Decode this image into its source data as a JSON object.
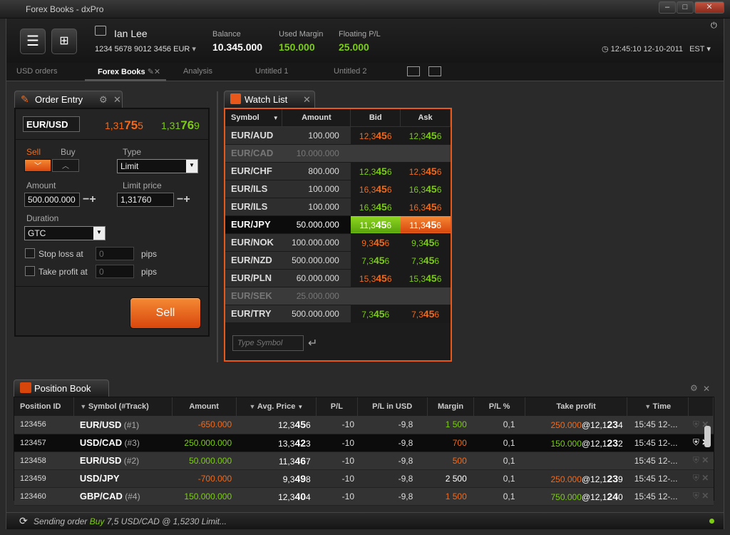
{
  "window": {
    "title": "Forex Books - dxPro"
  },
  "account": {
    "name": "Ian Lee",
    "number": "1234 5678 9012 3456",
    "currency": "EUR"
  },
  "balances": [
    {
      "label": "Balance",
      "value": "10.345.000",
      "color": "#ffffff"
    },
    {
      "label": "Used Margin",
      "value": "150.000",
      "color": "#7ccd13"
    },
    {
      "label": "Floating P/L",
      "value": "25.000",
      "color": "#7ccd13"
    }
  ],
  "clock": {
    "time": "12:45:10 12-10-2011",
    "tz": "EST"
  },
  "tabs": [
    "USD orders",
    "Forex Books",
    "Analysis",
    "Untitled 1",
    "Untitled 2"
  ],
  "active_tab": "Forex Books",
  "order_entry": {
    "title": "Order Entry",
    "symbol": "EUR/USD",
    "bid": {
      "pre": "1,31",
      "big": "75",
      "sup": "5"
    },
    "ask": {
      "pre": "1,31",
      "big": "76",
      "sup": "9"
    },
    "sell_label": "Sell",
    "buy_label": "Buy",
    "type_label": "Type",
    "type_value": "Limit",
    "amount_label": "Amount",
    "amount_value": "500.000.000",
    "limit_label": "Limit price",
    "limit_value": "1,31760",
    "duration_label": "Duration",
    "duration_value": "GTC",
    "stop_loss_label": "Stop loss at",
    "stop_loss_value": "0",
    "take_profit_label": "Take profit at",
    "take_profit_value": "0",
    "pips": "pips",
    "sell_button": "Sell"
  },
  "watchlist": {
    "title": "Watch List",
    "headers": [
      "Symbol",
      "Amount",
      "Bid",
      "Ask"
    ],
    "placeholder": "Type Symbol",
    "rows": [
      {
        "sym": "EUR/AUD",
        "amt": "100.000",
        "bid": {
          "pre": "12,3",
          "big": "45",
          "sup": "6",
          "c": "o"
        },
        "ask": {
          "pre": "12,3",
          "big": "45",
          "sup": "6",
          "c": "g"
        }
      },
      {
        "sym": "EUR/CAD",
        "amt": "10.000.000",
        "dim": true
      },
      {
        "sym": "EUR/CHF",
        "amt": "800.000",
        "bid": {
          "pre": "12,3",
          "big": "45",
          "sup": "6",
          "c": "g"
        },
        "ask": {
          "pre": "12,3",
          "big": "45",
          "sup": "6",
          "c": "o"
        }
      },
      {
        "sym": "EUR/ILS",
        "amt": "100.000",
        "bid": {
          "pre": "16,3",
          "big": "45",
          "sup": "6",
          "c": "o"
        },
        "ask": {
          "pre": "16,3",
          "big": "45",
          "sup": "6",
          "c": "g"
        }
      },
      {
        "sym": "EUR/ILS",
        "amt": "100.000",
        "bid": {
          "pre": "16,3",
          "big": "45",
          "sup": "6",
          "c": "g"
        },
        "ask": {
          "pre": "16,3",
          "big": "45",
          "sup": "6",
          "c": "o"
        }
      },
      {
        "sym": "EUR/JPY",
        "amt": "50.000.000",
        "sel": true,
        "bid": {
          "pre": "11,3",
          "big": "45",
          "sup": "6",
          "c": "w"
        },
        "ask": {
          "pre": "11,3",
          "big": "45",
          "sup": "6",
          "c": "w"
        }
      },
      {
        "sym": "EUR/NOK",
        "amt": "100.000.000",
        "bid": {
          "pre": "9,3",
          "big": "45",
          "sup": "6",
          "c": "o"
        },
        "ask": {
          "pre": "9,3",
          "big": "45",
          "sup": "6",
          "c": "g"
        }
      },
      {
        "sym": "EUR/NZD",
        "amt": "500.000.000",
        "bid": {
          "pre": "7,3",
          "big": "45",
          "sup": "6",
          "c": "g"
        },
        "ask": {
          "pre": "7,3",
          "big": "45",
          "sup": "6",
          "c": "g"
        }
      },
      {
        "sym": "EUR/PLN",
        "amt": "60.000.000",
        "bid": {
          "pre": "15,3",
          "big": "45",
          "sup": "6",
          "c": "o"
        },
        "ask": {
          "pre": "15,3",
          "big": "45",
          "sup": "6",
          "c": "g"
        }
      },
      {
        "sym": "EUR/SEK",
        "amt": "25.000.000",
        "dim": true
      },
      {
        "sym": "EUR/TRY",
        "amt": "500.000.000",
        "bid": {
          "pre": "7,3",
          "big": "45",
          "sup": "6",
          "c": "g"
        },
        "ask": {
          "pre": "7,3",
          "big": "45",
          "sup": "6",
          "c": "o"
        }
      }
    ]
  },
  "position_book": {
    "title": "Position Book",
    "headers": [
      "Position ID",
      "Symbol (#Track)",
      "Amount",
      "Avg. Price",
      "P/L",
      "P/L in USD",
      "Margin",
      "P/L %",
      "Take profit",
      "Time"
    ],
    "rows": [
      {
        "id": "123456",
        "sym": "EUR/USD",
        "track": "(#1)",
        "amt": "-650.000",
        "ac": "o",
        "avg": {
          "pre": "12,3",
          "big": "45",
          "sup": "6"
        },
        "pl": "-10",
        "plusd": "-9,8",
        "margin": "1 500",
        "mc": "g",
        "plp": "0,1",
        "tp_amt": "250.000",
        "tc": "o",
        "tp": {
          "pre": "@12,1",
          "big": "23",
          "sup": "4"
        },
        "time": "15:45 12-..."
      },
      {
        "id": "123457",
        "sym": "USD/CAD",
        "track": "(#3)",
        "amt": "250.000.000",
        "ac": "g",
        "avg": {
          "pre": "13,3",
          "big": "42",
          "sup": "3"
        },
        "pl": "-10",
        "plusd": "-9,8",
        "margin": "700",
        "mc": "o",
        "plp": "0,1",
        "tp_amt": "150.000",
        "tc": "g",
        "tp": {
          "pre": "@12,1",
          "big": "23",
          "sup": "2"
        },
        "time": "15:45 12-...",
        "sel": true
      },
      {
        "id": "123458",
        "sym": "EUR/USD",
        "track": "(#2)",
        "amt": "50.000.000",
        "ac": "g",
        "avg": {
          "pre": "11,3",
          "big": "46",
          "sup": "7"
        },
        "pl": "-10",
        "plusd": "-9,8",
        "margin": "500",
        "mc": "o",
        "plp": "0,1",
        "tp_amt": "",
        "tc": "o",
        "tp": {
          "pre": "",
          "big": "",
          "sup": ""
        },
        "time": "15:45 12-..."
      },
      {
        "id": "123459",
        "sym": "USD/JPY",
        "track": "",
        "amt": "-700.000",
        "ac": "o",
        "avg": {
          "pre": "9,3",
          "big": "49",
          "sup": "8"
        },
        "pl": "-10",
        "plusd": "-9,8",
        "margin": "2 500",
        "mc": "w",
        "plp": "0,1",
        "tp_amt": "250.000",
        "tc": "o",
        "tp": {
          "pre": "@12,1",
          "big": "23",
          "sup": "9"
        },
        "time": "15:45 12-..."
      },
      {
        "id": "123460",
        "sym": "GBP/CAD",
        "track": "(#4)",
        "amt": "150.000.000",
        "ac": "g",
        "avg": {
          "pre": "12,3",
          "big": "40",
          "sup": "4"
        },
        "pl": "-10",
        "plusd": "-9,8",
        "margin": "1 500",
        "mc": "o",
        "plp": "0,1",
        "tp_amt": "750.000",
        "tc": "g",
        "tp": {
          "pre": "@12,1",
          "big": "24",
          "sup": "0"
        },
        "time": "15:45 12-..."
      }
    ]
  },
  "status": {
    "pre": "Sending order ",
    "side": "Buy",
    "rest": " 7,5 USD/CAD @ 1,5230 Limit..."
  }
}
